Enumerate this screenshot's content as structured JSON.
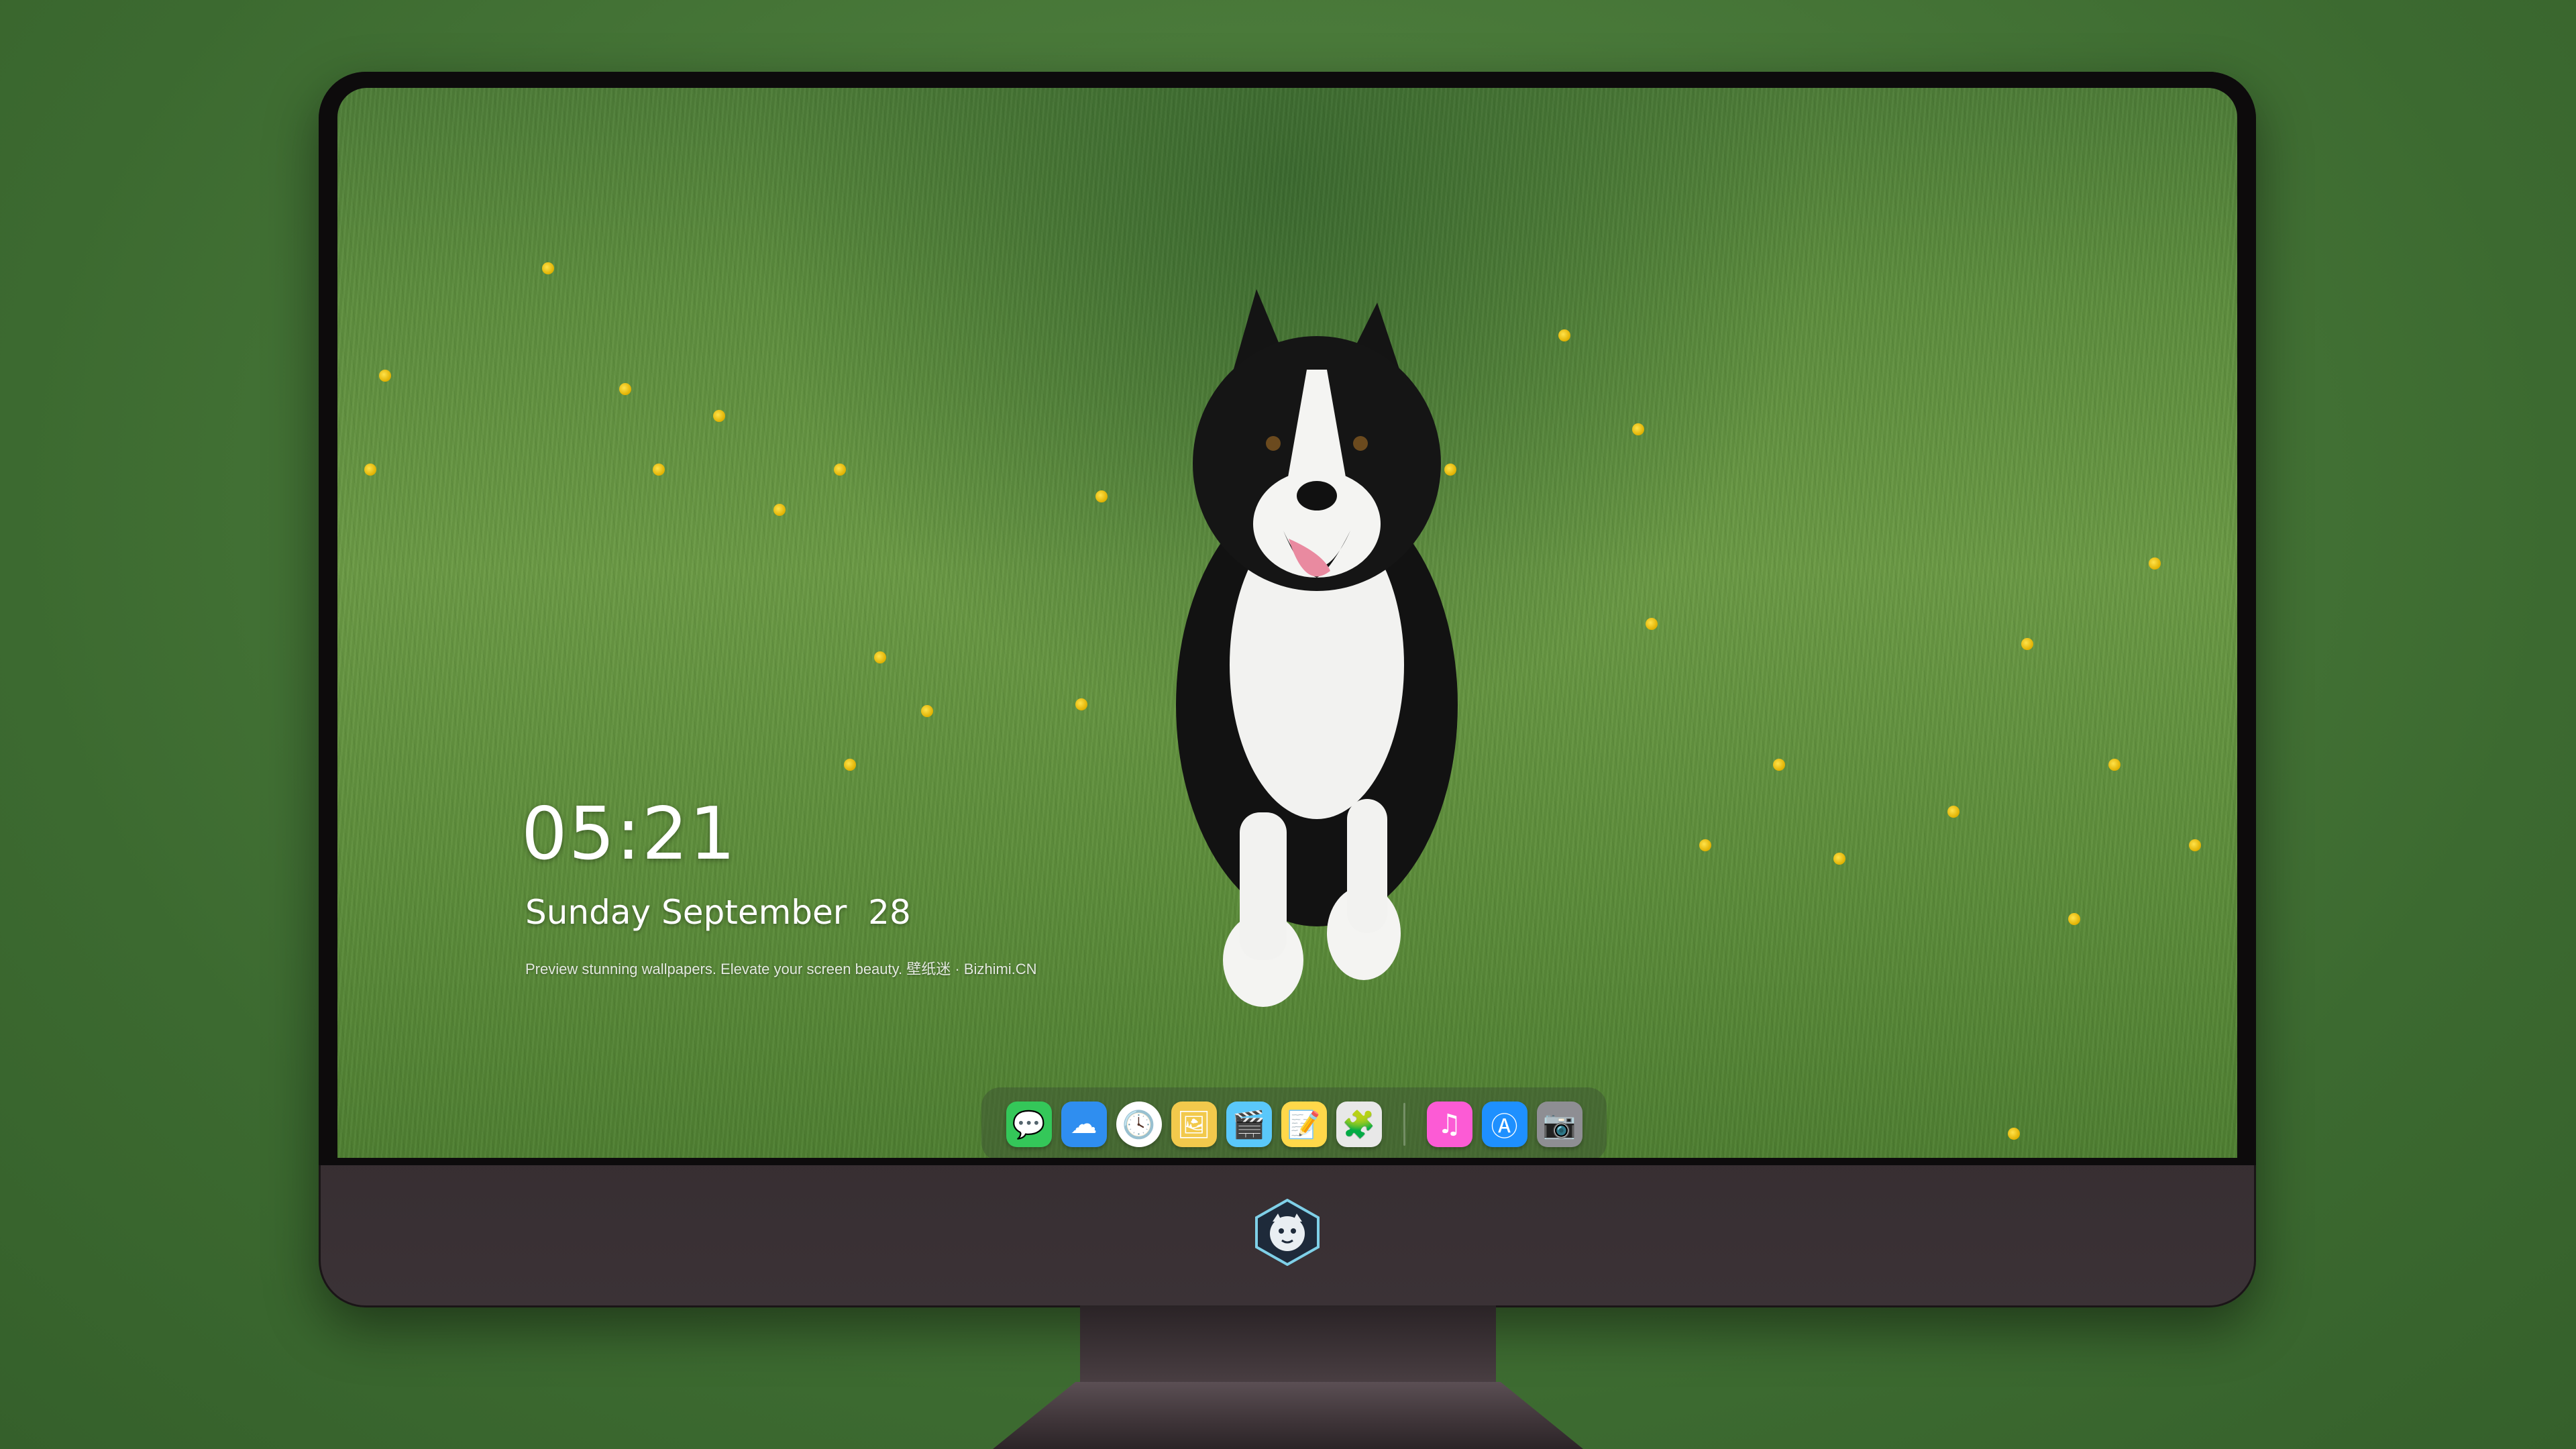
{
  "lock_screen": {
    "time": "05:21",
    "date": "Sunday September  28",
    "caption": "Preview stunning wallpapers. Elevate your screen beauty. 壁纸迷 · Bizhimi.CN"
  },
  "dock": {
    "apps": [
      {
        "name": "messages",
        "icon": "messages-icon",
        "color": "#34c759",
        "glyph": "💬"
      },
      {
        "name": "weather",
        "icon": "weather-icon",
        "color": "#2f8ef0",
        "glyph": "☁"
      },
      {
        "name": "clock",
        "icon": "clock-icon",
        "color": "#ffffff",
        "glyph": "🕓"
      },
      {
        "name": "preview",
        "icon": "preview-icon",
        "color": "#f2c94c",
        "glyph": "🖼"
      },
      {
        "name": "clips",
        "icon": "clips-icon",
        "color": "#5ac8fa",
        "glyph": "🎬"
      },
      {
        "name": "notes",
        "icon": "notes-icon",
        "color": "#ffd84a",
        "glyph": "📝"
      },
      {
        "name": "photo-booth",
        "icon": "photo-booth-icon",
        "color": "#e8e8e8",
        "glyph": "🧩"
      },
      {
        "name": "music",
        "icon": "music-icon",
        "color": "#fc5bd5",
        "glyph": "♫"
      },
      {
        "name": "app-store",
        "icon": "app-store-icon",
        "color": "#1e90ff",
        "glyph": "Ⓐ"
      },
      {
        "name": "camera",
        "icon": "camera-icon",
        "color": "#8e8e93",
        "glyph": "📷"
      }
    ]
  },
  "colors": {
    "bezel": "#0d0b0c",
    "chin": "#2e2629",
    "grass": "#5e8e3e"
  }
}
